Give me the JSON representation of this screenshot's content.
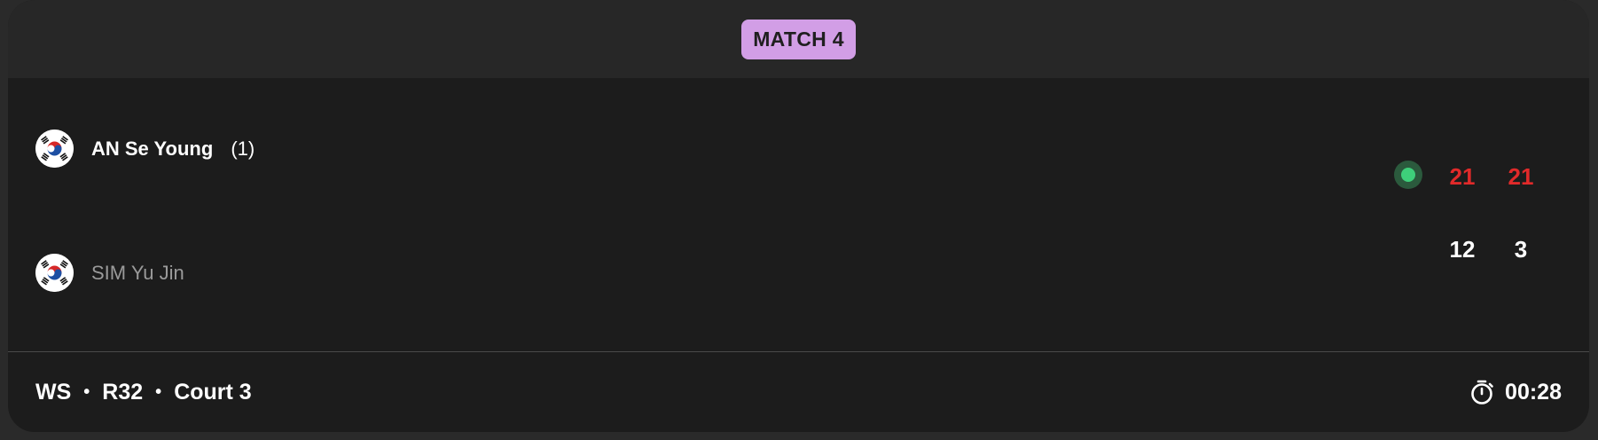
{
  "header": {
    "badge_label": "MATCH 4"
  },
  "players": [
    {
      "name": "AN Se Young",
      "seed": "(1)",
      "country_flag": "korea-flag-icon",
      "winner": true
    },
    {
      "name": "SIM Yu Jin",
      "seed": "",
      "country_flag": "korea-flag-icon",
      "winner": false
    }
  ],
  "scores": {
    "player1": [
      "21",
      "21"
    ],
    "player2": [
      "12",
      "3"
    ]
  },
  "footer": {
    "event": "WS",
    "round": "R32",
    "court": "Court 3",
    "separator": "•",
    "duration": "00:28",
    "timer_icon": "stopwatch-icon"
  },
  "colors": {
    "badge_bg": "#d29ee6",
    "winning_score": "#e12a2a",
    "serve_indicator": "#3ecf7a",
    "card_bg": "#1c1c1c",
    "header_bg": "#272727"
  }
}
